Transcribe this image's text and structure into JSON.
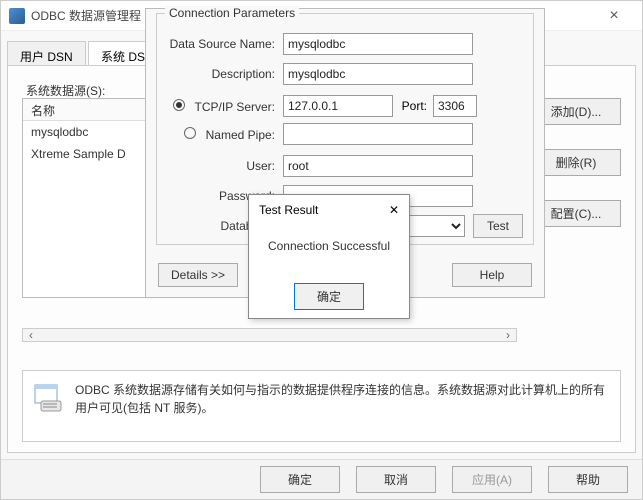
{
  "window": {
    "title": "ODBC 数据源管理程"
  },
  "tabs": {
    "user": "用户 DSN",
    "system": "系统 DSN"
  },
  "list": {
    "group_label": "系统数据源(S):",
    "col_name": "名称",
    "items": [
      "mysqlodbc",
      "Xtreme Sample D"
    ]
  },
  "side": {
    "add": "添加(D)...",
    "remove": "删除(R)",
    "config": "配置(C)..."
  },
  "info": {
    "text": "ODBC 系统数据源存储有关如何与指示的数据提供程序连接的信息。系统数据源对此计算机上的所有用户可见(包括 NT 服务)。"
  },
  "footer": {
    "ok": "确定",
    "cancel": "取消",
    "apply": "应用(A)",
    "help": "帮助"
  },
  "conn": {
    "group": "Connection Parameters",
    "dsn_label": "Data Source Name:",
    "dsn": "mysqlodbc",
    "desc_label": "Description:",
    "desc": "mysqlodbc",
    "tcp_label": "TCP/IP Server:",
    "tcp": "127.0.0.1",
    "port_label": "Port:",
    "port": "3306",
    "pipe_label": "Named Pipe:",
    "user_label": "User:",
    "user": "root",
    "pass_label": "Password:",
    "pass": "••••••",
    "db_label": "Database",
    "details": "Details >>",
    "test": "Test",
    "help": "Help"
  },
  "modal": {
    "title": "Test Result",
    "msg": "Connection Successful",
    "ok": "确定"
  }
}
